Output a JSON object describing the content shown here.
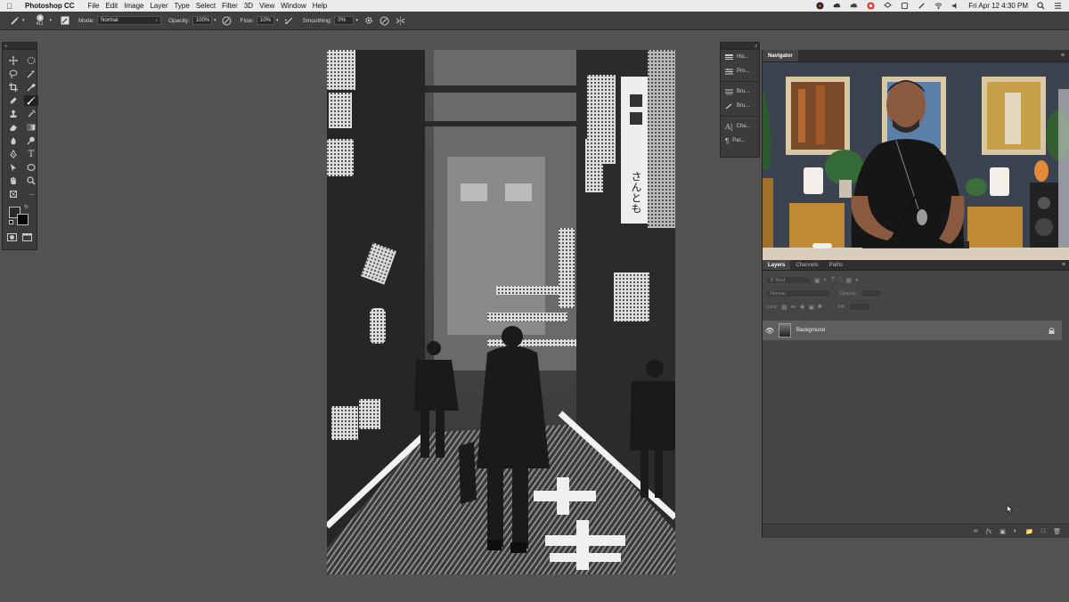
{
  "menubar": {
    "apple": "",
    "app_name": "Photoshop CC",
    "items": [
      "File",
      "Edit",
      "Image",
      "Layer",
      "Type",
      "Select",
      "Filter",
      "3D",
      "View",
      "Window",
      "Help"
    ],
    "clock": "Fri Apr 12  4:30 PM"
  },
  "options": {
    "brush_size": "411",
    "mode_label": "Mode:",
    "mode_value": "Normal",
    "opacity_label": "Opacity:",
    "opacity_value": "100%",
    "flow_label": "Flow:",
    "flow_value": "10%",
    "smoothing_label": "Smoothing:",
    "smoothing_value": "0%"
  },
  "tools": [
    "move-tool",
    "marquee-tool",
    "lasso-tool",
    "magic-wand-tool",
    "crop-tool",
    "eyedropper-tool",
    "healing-tool",
    "brush-tool",
    "stamp-tool",
    "history-brush-tool",
    "eraser-tool",
    "gradient-tool",
    "blur-tool",
    "dodge-tool",
    "pen-tool",
    "type-tool",
    "path-select-tool",
    "shape-tool",
    "hand-tool",
    "zoom-tool",
    "frame-tool",
    "more-tools"
  ],
  "dock": {
    "items": [
      {
        "label": "His...",
        "icon": "history-icon"
      },
      {
        "label": "Pro...",
        "icon": "properties-icon"
      },
      {
        "label": "Bru...",
        "icon": "brush-settings-icon"
      },
      {
        "label": "Bru...",
        "icon": "brushes-icon"
      },
      {
        "label": "Cha...",
        "icon": "character-icon"
      },
      {
        "label": "Par...",
        "icon": "paragraph-icon"
      }
    ]
  },
  "navigator": {
    "tab": "Navigator"
  },
  "layers": {
    "tabs": [
      "Layers",
      "Channels",
      "Paths"
    ],
    "filter_placeholder": "Kind",
    "blend_mode": "Normal",
    "opacity_label": "Opacity:",
    "lock_label": "Lock:",
    "fill_label": "Fill:",
    "layer_name": "Background"
  },
  "canvas": {
    "sign_text": "さんとも"
  }
}
